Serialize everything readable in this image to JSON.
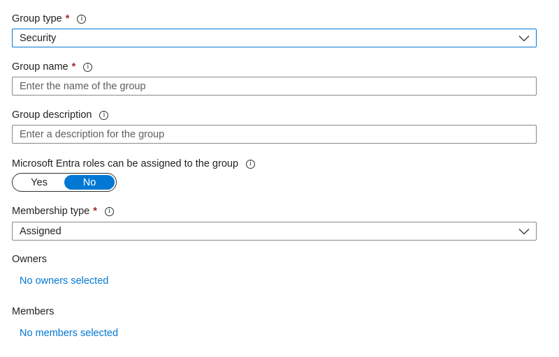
{
  "group_type": {
    "label": "Group type",
    "required_marker": "*",
    "value": "Security"
  },
  "group_name": {
    "label": "Group name",
    "required_marker": "*",
    "placeholder": "Enter the name of the group",
    "value": ""
  },
  "group_description": {
    "label": "Group description",
    "placeholder": "Enter a description for the group",
    "value": ""
  },
  "entra_roles": {
    "label": "Microsoft Entra roles can be assigned to the group",
    "options": [
      "Yes",
      "No"
    ],
    "selected": "No"
  },
  "membership_type": {
    "label": "Membership type",
    "required_marker": "*",
    "value": "Assigned"
  },
  "owners": {
    "label": "Owners",
    "link": "No owners selected"
  },
  "members": {
    "label": "Members",
    "link": "No members selected"
  },
  "icons": {
    "info": "info-icon",
    "dropdown": "chevron-down-icon"
  },
  "colors": {
    "accent": "#0078d4",
    "required": "#a4262c",
    "text": "#201f1e",
    "border": "#8a8886"
  }
}
